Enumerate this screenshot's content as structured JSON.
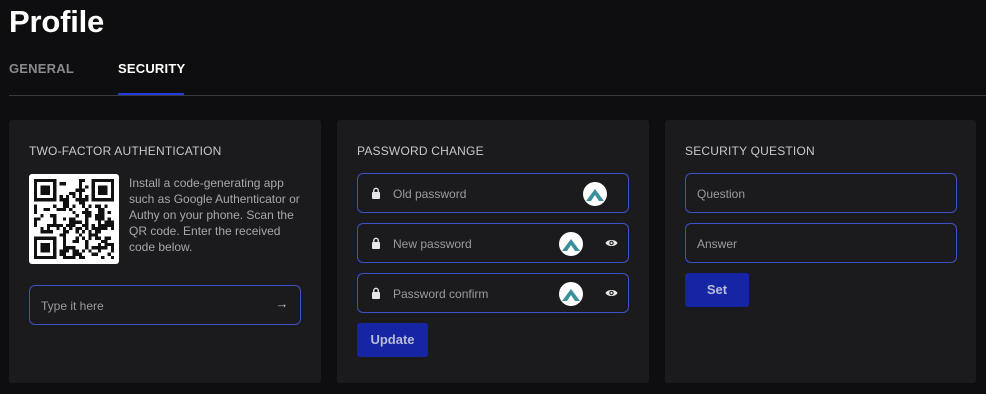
{
  "page": {
    "title": "Profile"
  },
  "tabs": [
    {
      "label": "GENERAL"
    },
    {
      "label": "SECURITY"
    }
  ],
  "two_factor": {
    "title": "TWO-FACTOR AUTHENTICATION",
    "description": "Install a code-generating app such as Google Authenticator or Authy on your phone. Scan the QR code. Enter the received code below.",
    "input_placeholder": "Type it here",
    "submit_icon": "arrow-right-icon"
  },
  "password_change": {
    "title": "PASSWORD CHANGE",
    "old_placeholder": "Old password",
    "new_placeholder": "New password",
    "confirm_placeholder": "Password confirm",
    "update_label": "Update"
  },
  "security_question": {
    "title": "SECURITY QUESTION",
    "question_placeholder": "Question",
    "answer_placeholder": "Answer",
    "set_label": "Set"
  },
  "colors": {
    "accent": "#1f3ee0",
    "button": "#1525a3",
    "field_border": "#3b52c9",
    "card": "#1b1b1e",
    "background": "#0e0e10",
    "badge_mountain": "#3a8f9a"
  }
}
